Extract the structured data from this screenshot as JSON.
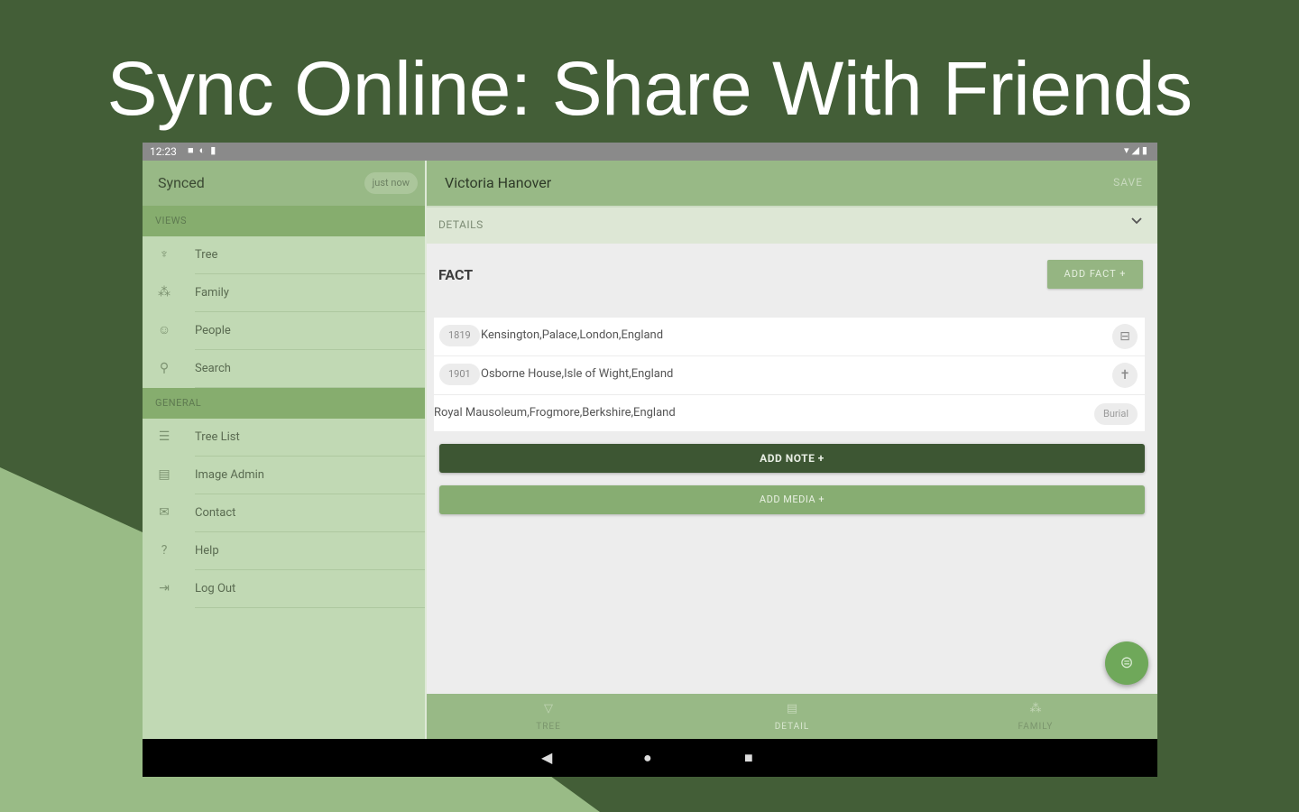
{
  "headline": "Sync Online: Share With Friends",
  "colors": {
    "background": "#435e37",
    "light_shape": "#99bb86",
    "accent": "#98b986",
    "dark_button": "#3d5633"
  },
  "status_bar": {
    "time": "12:23"
  },
  "drawer": {
    "title": "Synced",
    "sync_chip": "just now",
    "sections": [
      {
        "label": "VIEWS",
        "items": [
          {
            "icon": "tree-icon",
            "label": "Tree"
          },
          {
            "icon": "family-icon",
            "label": "Family"
          },
          {
            "icon": "person-icon",
            "label": "People"
          },
          {
            "icon": "search-icon",
            "label": "Search"
          }
        ]
      },
      {
        "label": "GENERAL",
        "items": [
          {
            "icon": "list-icon",
            "label": "Tree List"
          },
          {
            "icon": "image-icon",
            "label": "Image Admin"
          },
          {
            "icon": "mail-icon",
            "label": "Contact"
          },
          {
            "icon": "help-icon",
            "label": "Help"
          },
          {
            "icon": "logout-icon",
            "label": "Log Out"
          }
        ]
      }
    ]
  },
  "main": {
    "person_name": "Victoria Hanover",
    "save_label": "SAVE",
    "details_label": "DETAILS",
    "fact_heading": "FACT",
    "add_fact_label": "ADD FACT +",
    "facts": [
      {
        "year": "1819",
        "place": "Kensington,Palace,London,England",
        "type_icon": "cradle-icon"
      },
      {
        "year": "1901",
        "place": "Osborne House,Isle of Wight,England",
        "type_icon": "cross-icon"
      },
      {
        "year": "",
        "place": "Royal Mausoleum,Frogmore,Berkshire,England",
        "type_label": "Burial"
      }
    ],
    "add_note_label": "ADD NOTE +",
    "add_media_label": "ADD MEDIA +",
    "fab_icon": "sync-icon"
  },
  "bottom_nav": [
    {
      "icon": "tree-icon",
      "label": "TREE",
      "active": false
    },
    {
      "icon": "detail-icon",
      "label": "DETAIL",
      "active": true
    },
    {
      "icon": "family-icon",
      "label": "FAMILY",
      "active": false
    }
  ]
}
